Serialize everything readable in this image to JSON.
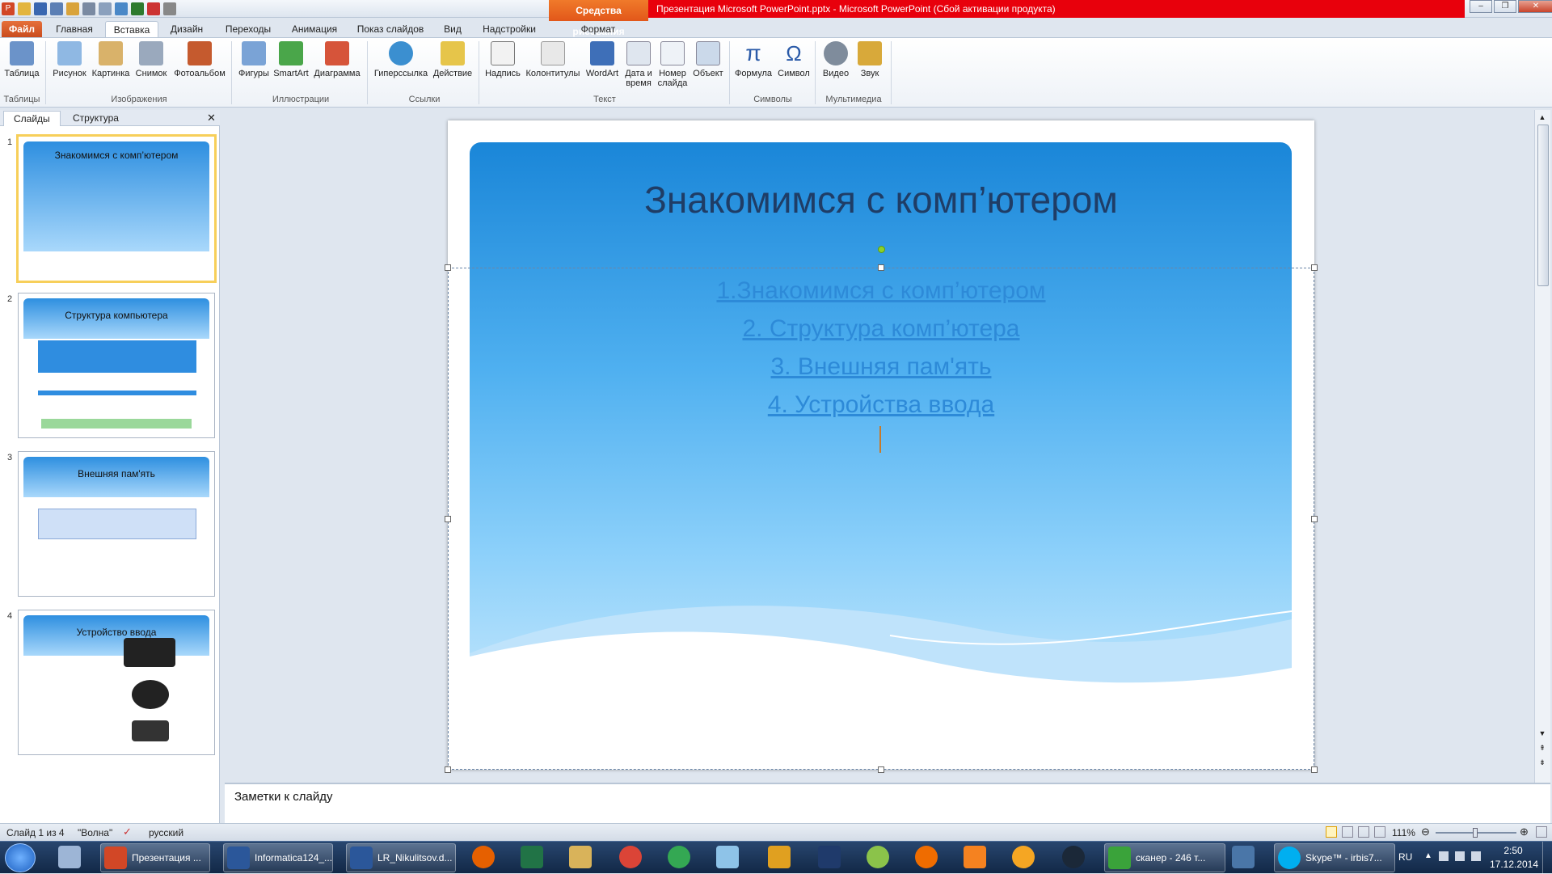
{
  "app": {
    "title": "Презентация Microsoft PowerPoint.pptx  -  Microsoft PowerPoint (Сбой активации продукта)",
    "context_header": "Средства рисования"
  },
  "tabs": [
    "Файл",
    "Главная",
    "Вставка",
    "Дизайн",
    "Переходы",
    "Анимация",
    "Показ слайдов",
    "Вид",
    "Надстройки",
    "Формат"
  ],
  "ribbon": {
    "buttons": {
      "table": "Таблица",
      "picture": "Рисунок",
      "clipart": "Картинка",
      "screenshot": "Снимок",
      "album": "Фотоальбом",
      "shapes": "Фигуры",
      "smartart": "SmartArt",
      "chart": "Диаграмма",
      "hyperlink": "Гиперссылка",
      "action": "Действие",
      "textbox": "Надпись",
      "headerfooter": "Колонтитулы",
      "wordart": "WordArt",
      "datetime": "Дата и время",
      "slidenumber": "Номер слайда",
      "object": "Объект",
      "equation": "Формула",
      "symbol": "Символ",
      "video": "Видео",
      "audio": "Звук"
    },
    "groups": {
      "tables": "Таблицы",
      "images": "Изображения",
      "illustrations": "Иллюстрации",
      "links": "Ссылки",
      "text": "Текст",
      "symbols": "Символы",
      "media": "Мультимедиа"
    }
  },
  "left_pane": {
    "tab_slides": "Слайды",
    "tab_outline": "Структура",
    "thumbnails": [
      {
        "num": "1",
        "title": "Знакомимся с комп’ютером"
      },
      {
        "num": "2",
        "title": "Структура компьютера"
      },
      {
        "num": "3",
        "title": "Внешняя пам'ять"
      },
      {
        "num": "4",
        "title": "Устройство ввода"
      }
    ]
  },
  "slide": {
    "title": "Знакомимся с комп’ютером",
    "links": [
      "1.Знакомимся с комп’ютером",
      "2. Структура комп’ютера",
      "3. Внешняя пам'ять",
      "4. Устройства ввода"
    ]
  },
  "notes": {
    "placeholder": "Заметки к слайду"
  },
  "status": {
    "slide_info": "Слайд 1 из 4",
    "theme": "\"Волна\"",
    "language": "русский",
    "zoom": "111%"
  },
  "taskbar": {
    "buttons": [
      "Презентация ...",
      "Informatica124_...",
      "LR_Nikulitsov.d...",
      "сканер - 246 т...",
      "Skype™ - irbis7..."
    ],
    "lang": "RU",
    "time": "2:50",
    "date": "17.12.2014"
  },
  "colors": {
    "accent_red": "#e8000c",
    "context_orange": "#e2571a",
    "slide_blue": "#1a86d8",
    "link_blue": "#2d8ad8"
  }
}
